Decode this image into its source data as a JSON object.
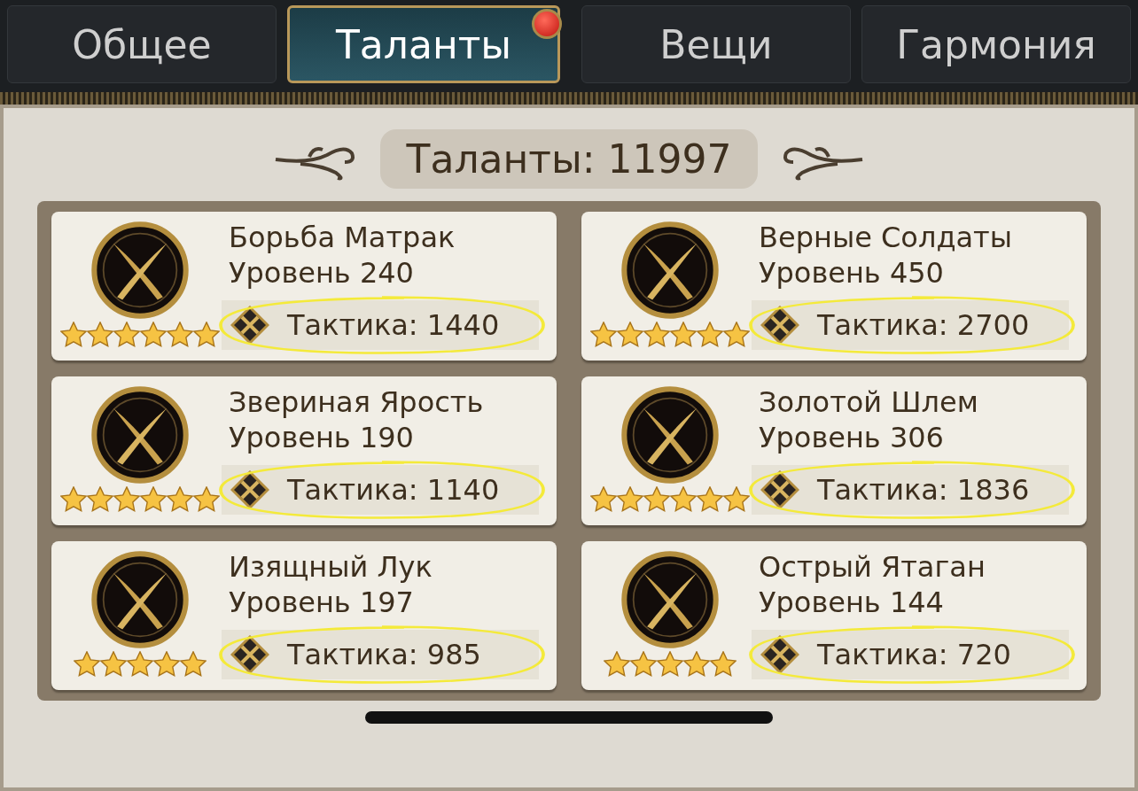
{
  "tabs": [
    {
      "label": "Общее",
      "selected": false,
      "badge": false
    },
    {
      "label": "Таланты",
      "selected": true,
      "badge": true
    },
    {
      "label": "Вещи",
      "selected": false,
      "badge": false
    },
    {
      "label": "Гармония",
      "selected": false,
      "badge": false
    }
  ],
  "title": "Таланты: 11997",
  "talents": [
    {
      "name": "Борьба Матрак",
      "level": "Уровень 240",
      "stat": "Тактика: 1440",
      "stars": 6,
      "highlighted": true
    },
    {
      "name": "Верные Солдаты",
      "level": "Уровень 450",
      "stat": "Тактика: 2700",
      "stars": 6,
      "highlighted": true
    },
    {
      "name": "Звериная Ярость",
      "level": "Уровень 190",
      "stat": "Тактика: 1140",
      "stars": 6,
      "highlighted": true
    },
    {
      "name": "Золотой Шлем",
      "level": "Уровень 306",
      "stat": "Тактика: 1836",
      "stars": 6,
      "highlighted": true
    },
    {
      "name": "Изящный Лук",
      "level": "Уровень 197",
      "stat": "Тактика: 985",
      "stars": 5,
      "highlighted": true
    },
    {
      "name": "Острый Ятаган",
      "level": "Уровень 144",
      "stat": "Тактика: 720",
      "stars": 5,
      "highlighted": true
    }
  ]
}
